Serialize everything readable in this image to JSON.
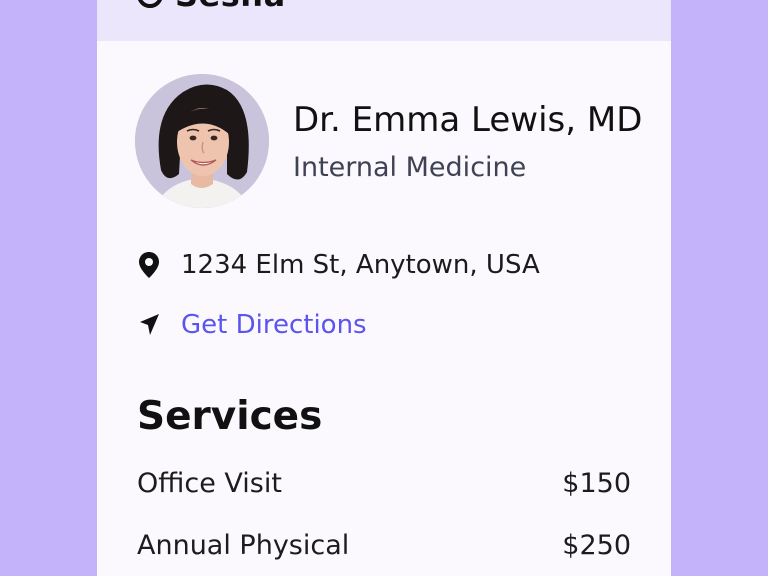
{
  "app": {
    "brand_name": "Sesha",
    "logo_icon": "brand-logo-icon"
  },
  "doctor": {
    "name": "Dr. Emma Lewis, MD",
    "specialty": "Internal Medicine",
    "avatar_icon": "doctor-avatar"
  },
  "location": {
    "address": "1234 Elm St, Anytown, USA",
    "address_icon": "map-pin-icon",
    "directions_label": "Get Directions",
    "directions_icon": "navigation-arrow-icon"
  },
  "services": {
    "title": "Services",
    "items": [
      {
        "name": "Office Visit",
        "price": "$150"
      },
      {
        "name": "Annual Physical",
        "price": "$250"
      }
    ]
  },
  "colors": {
    "background": "#c4b3fa",
    "card": "#fbf9fe",
    "header": "#ece6fd",
    "link": "#5b55f0"
  }
}
